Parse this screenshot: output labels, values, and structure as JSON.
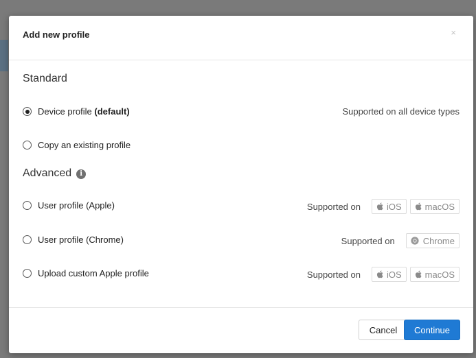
{
  "modal": {
    "title": "Add new profile",
    "close_label": "×"
  },
  "sections": {
    "standard": "Standard",
    "advanced": "Advanced"
  },
  "options": {
    "device": {
      "label": "Device profile",
      "label_suffix": "(default)",
      "support": "Supported on all device types",
      "selected": true
    },
    "copy": {
      "label": "Copy an existing profile",
      "selected": false
    },
    "user_apple": {
      "label": "User profile (Apple)",
      "support_prefix": "Supported on",
      "badges": [
        "iOS",
        "macOS"
      ],
      "selected": false
    },
    "user_chrome": {
      "label": "User profile (Chrome)",
      "support_prefix": "Supported on",
      "badges": [
        "Chrome"
      ],
      "selected": false
    },
    "upload_apple": {
      "label": "Upload custom Apple profile",
      "support_prefix": "Supported on",
      "badges": [
        "iOS",
        "macOS"
      ],
      "selected": false
    }
  },
  "icons": {
    "info": "info-icon",
    "apple": "apple-icon",
    "chrome": "chrome-icon",
    "close": "close-icon"
  },
  "footer": {
    "cancel_label": "Cancel",
    "continue_label": "Continue"
  },
  "colors": {
    "primary": "#1f7ad4",
    "overlay": "#7a7a7a"
  }
}
